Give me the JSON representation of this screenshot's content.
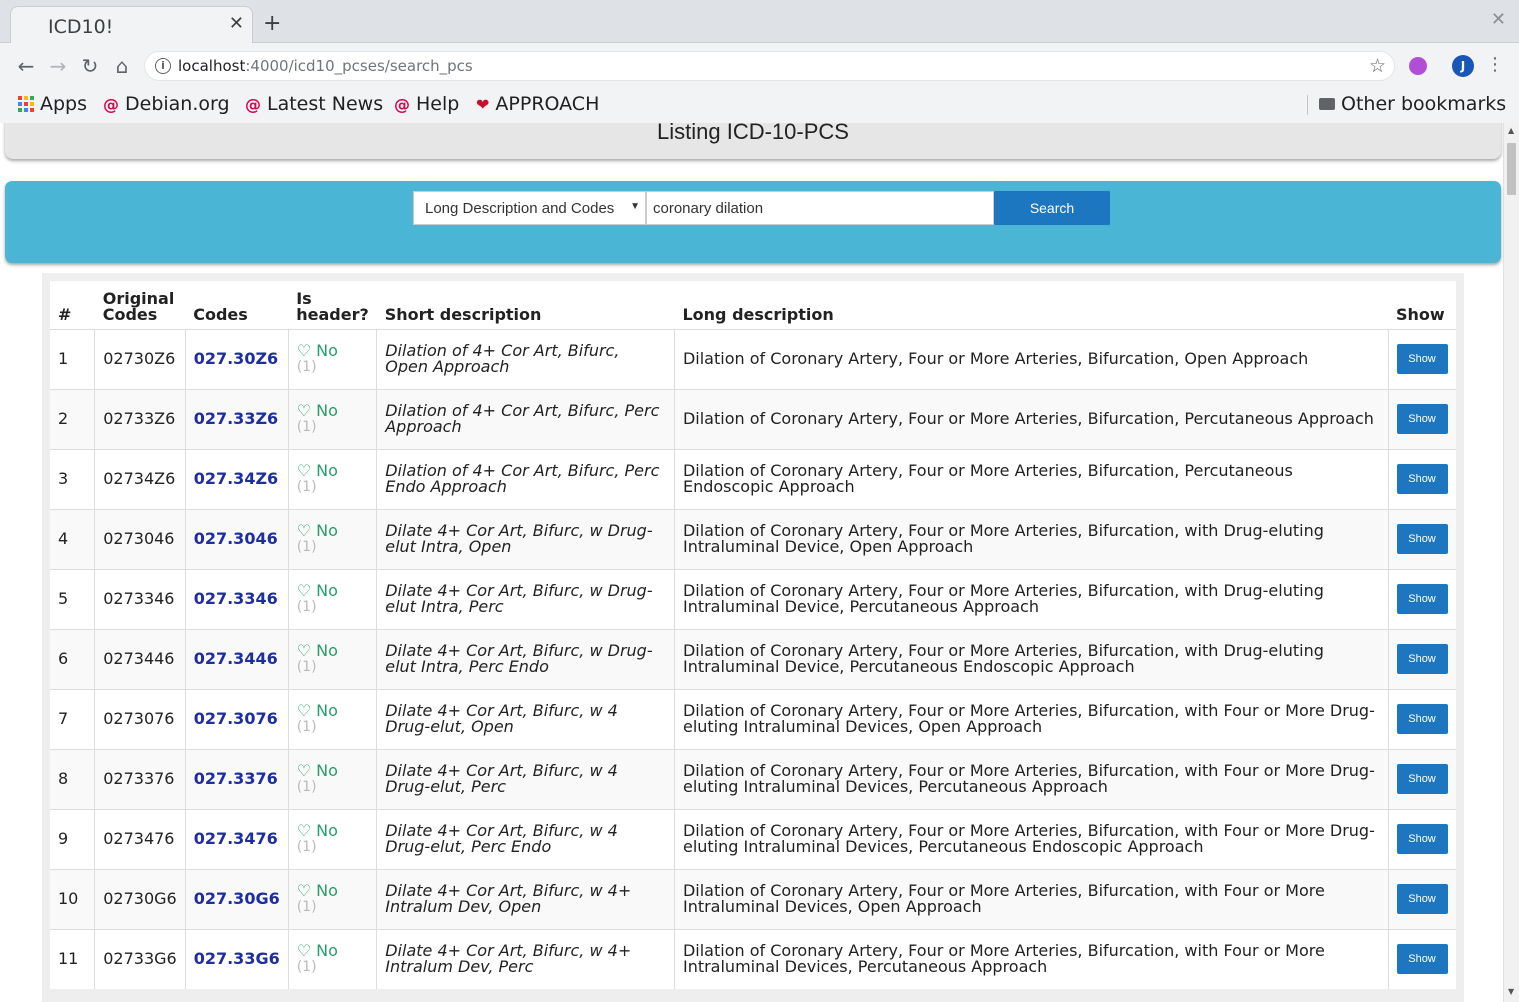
{
  "browser": {
    "tab_title": "ICD10!",
    "url_host": "localhost",
    "url_path": ":4000/icd10_pcses/search_pcs",
    "avatar_letter": "J",
    "bookmarks": [
      "Apps",
      "Debian.org",
      "Latest News",
      "Help",
      "APPROACH"
    ],
    "other_bookmarks": "Other bookmarks"
  },
  "page": {
    "title": "Listing ICD-10-PCS"
  },
  "search": {
    "select_value": "Long Description and Codes",
    "query": "coronary dilation",
    "button_label": "Search"
  },
  "table": {
    "headers": [
      "#",
      "Original Codes",
      "Codes",
      "Is header?",
      "Short description",
      "Long description",
      "Show"
    ],
    "rows": [
      {
        "n": "1",
        "orig": "02730Z6",
        "code": "027.30Z6",
        "hdr": "No",
        "count": "(1)",
        "short": "Dilation of 4+ Cor Art, Bifurc, Open Approach",
        "long": "Dilation of Coronary Artery, Four or More Arteries, Bifurcation, Open Approach",
        "show": "Show"
      },
      {
        "n": "2",
        "orig": "02733Z6",
        "code": "027.33Z6",
        "hdr": "No",
        "count": "(1)",
        "short": "Dilation of 4+ Cor Art, Bifurc, Perc Approach",
        "long": "Dilation of Coronary Artery, Four or More Arteries, Bifurcation, Percutaneous Approach",
        "show": "Show"
      },
      {
        "n": "3",
        "orig": "02734Z6",
        "code": "027.34Z6",
        "hdr": "No",
        "count": "(1)",
        "short": "Dilation of 4+ Cor Art, Bifurc, Perc Endo Approach",
        "long": "Dilation of Coronary Artery, Four or More Arteries, Bifurcation, Percutaneous Endoscopic Approach",
        "show": "Show"
      },
      {
        "n": "4",
        "orig": "0273046",
        "code": "027.3046",
        "hdr": "No",
        "count": "(1)",
        "short": "Dilate 4+ Cor Art, Bifurc, w Drug-elut Intra, Open",
        "long": "Dilation of Coronary Artery, Four or More Arteries, Bifurcation, with Drug-eluting Intraluminal Device, Open Approach",
        "show": "Show"
      },
      {
        "n": "5",
        "orig": "0273346",
        "code": "027.3346",
        "hdr": "No",
        "count": "(1)",
        "short": "Dilate 4+ Cor Art, Bifurc, w Drug-elut Intra, Perc",
        "long": "Dilation of Coronary Artery, Four or More Arteries, Bifurcation, with Drug-eluting Intraluminal Device, Percutaneous Approach",
        "show": "Show"
      },
      {
        "n": "6",
        "orig": "0273446",
        "code": "027.3446",
        "hdr": "No",
        "count": "(1)",
        "short": "Dilate 4+ Cor Art, Bifurc, w Drug-elut Intra, Perc Endo",
        "long": "Dilation of Coronary Artery, Four or More Arteries, Bifurcation, with Drug-eluting Intraluminal Device, Percutaneous Endoscopic Approach",
        "show": "Show"
      },
      {
        "n": "7",
        "orig": "0273076",
        "code": "027.3076",
        "hdr": "No",
        "count": "(1)",
        "short": "Dilate 4+ Cor Art, Bifurc, w 4 Drug-elut, Open",
        "long": "Dilation of Coronary Artery, Four or More Arteries, Bifurcation, with Four or More Drug-eluting Intraluminal Devices, Open Approach",
        "show": "Show"
      },
      {
        "n": "8",
        "orig": "0273376",
        "code": "027.3376",
        "hdr": "No",
        "count": "(1)",
        "short": "Dilate 4+ Cor Art, Bifurc, w 4 Drug-elut, Perc",
        "long": "Dilation of Coronary Artery, Four or More Arteries, Bifurcation, with Four or More Drug-eluting Intraluminal Devices, Percutaneous Approach",
        "show": "Show"
      },
      {
        "n": "9",
        "orig": "0273476",
        "code": "027.3476",
        "hdr": "No",
        "count": "(1)",
        "short": "Dilate 4+ Cor Art, Bifurc, w 4 Drug-elut, Perc Endo",
        "long": "Dilation of Coronary Artery, Four or More Arteries, Bifurcation, with Four or More Drug-eluting Intraluminal Devices, Percutaneous Endoscopic Approach",
        "show": "Show"
      },
      {
        "n": "10",
        "orig": "02730G6",
        "code": "027.30G6",
        "hdr": "No",
        "count": "(1)",
        "short": "Dilate 4+ Cor Art, Bifurc, w 4+ Intralum Dev, Open",
        "long": "Dilation of Coronary Artery, Four or More Arteries, Bifurcation, with Four or More Intraluminal Devices, Open Approach",
        "show": "Show"
      },
      {
        "n": "11",
        "orig": "02733G6",
        "code": "027.33G6",
        "hdr": "No",
        "count": "(1)",
        "short": "Dilate 4+ Cor Art, Bifurc, w 4+ Intralum Dev, Perc",
        "long": "Dilation of Coronary Artery, Four or More Arteries, Bifurcation, with Four or More Intraluminal Devices, Percutaneous Approach",
        "show": "Show"
      }
    ]
  },
  "colors": {
    "search_panel": "#4ab5d5",
    "button": "#1d77c0",
    "code_link": "#1c2ea0",
    "no_green": "#2a9d6e"
  }
}
